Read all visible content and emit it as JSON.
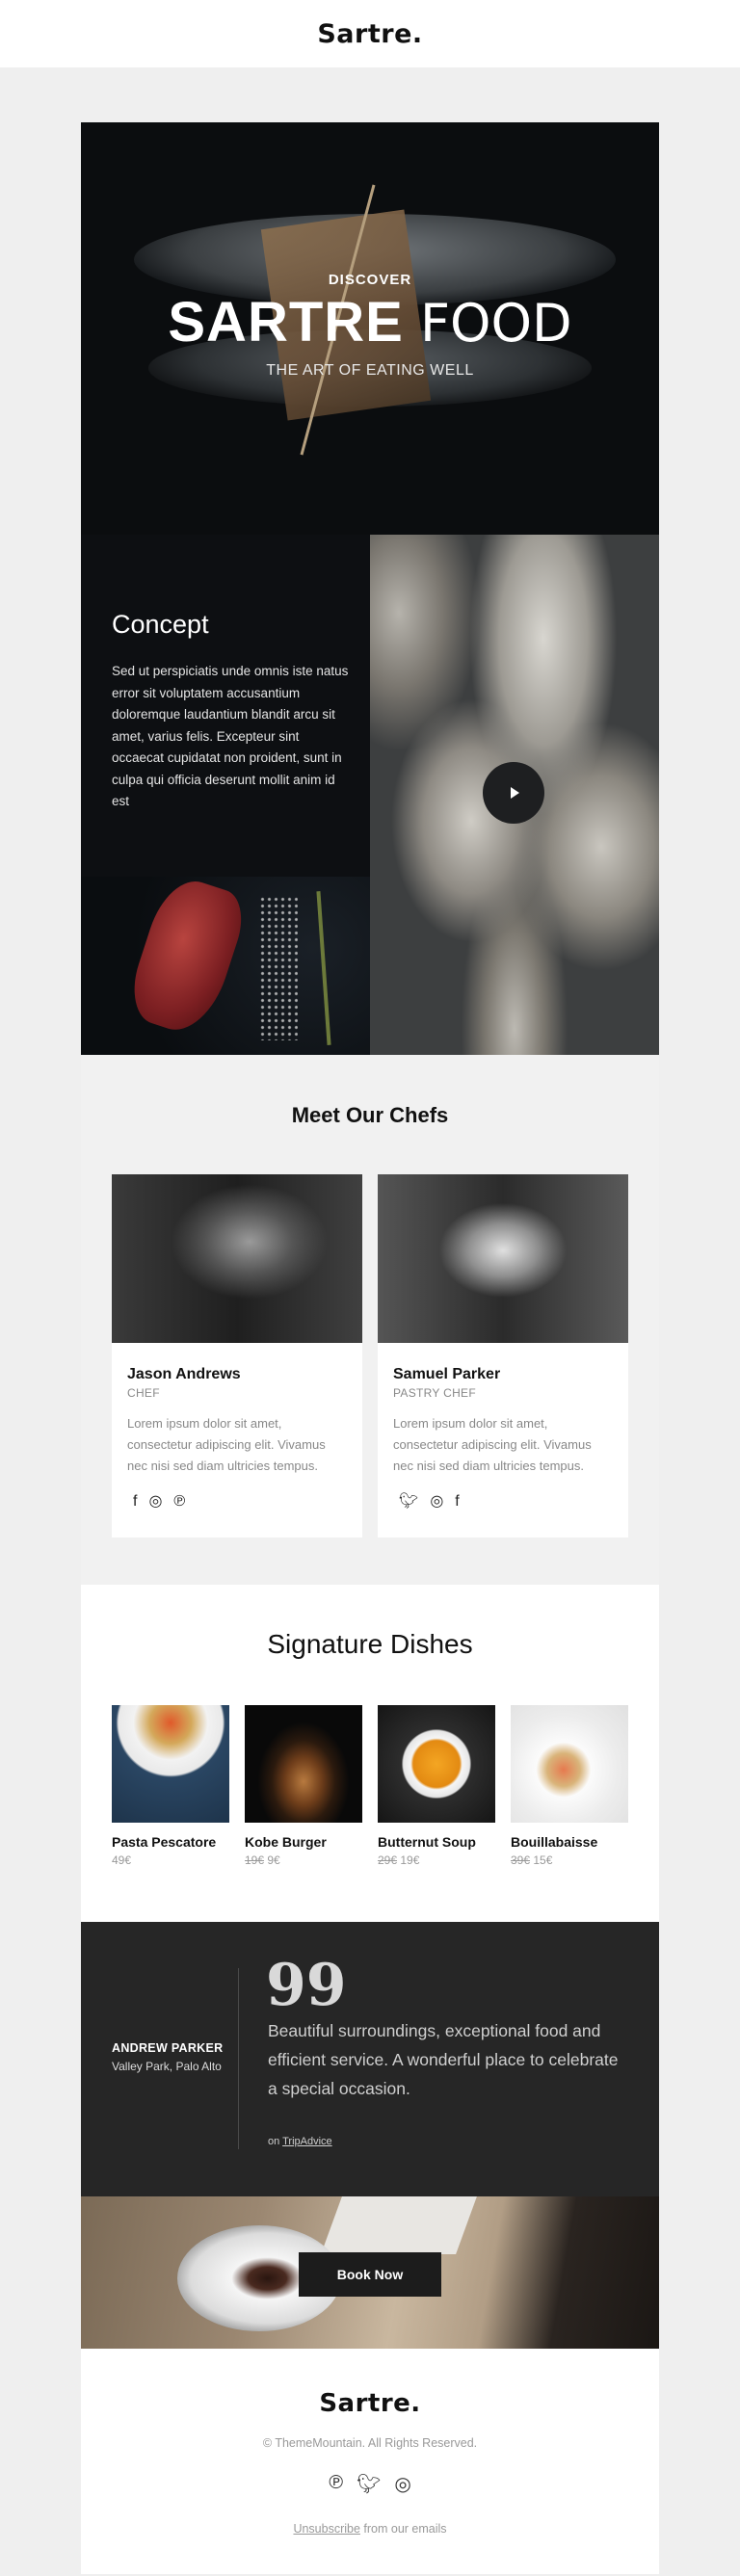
{
  "header": {
    "logo": "Sartre."
  },
  "hero": {
    "eyebrow": "DISCOVER",
    "title_bold": "SARTRE",
    "title_light": "FOOD",
    "tagline": "THE ART OF EATING WELL"
  },
  "concept": {
    "title": "Concept",
    "body": "Sed ut perspiciatis unde omnis iste natus error sit voluptatem accusantium doloremque laudantium blandit arcu sit amet, varius felis. Excepteur sint occaecat cupidatat non proident, sunt in culpa qui officia deserunt mollit anim id est",
    "play_icon": "play-icon"
  },
  "chefs": {
    "title": "Meet Our Chefs",
    "items": [
      {
        "name": "Jason Andrews",
        "role": "CHEF",
        "bio": "Lorem ipsum dolor sit amet, consectetur adipiscing elit. Vivamus nec nisi sed diam ultricies tempus.",
        "socials": [
          "facebook-icon",
          "instagram-icon",
          "pinterest-icon"
        ]
      },
      {
        "name": "Samuel Parker",
        "role": "PASTRY CHEF",
        "bio": "Lorem ipsum dolor sit amet, consectetur adipiscing elit. Vivamus nec nisi sed diam ultricies tempus.",
        "socials": [
          "twitter-icon",
          "instagram-icon",
          "facebook-icon"
        ]
      }
    ]
  },
  "dishes": {
    "title": "Signature Dishes",
    "items": [
      {
        "name": "Pasta Pescatore",
        "old_price": "",
        "price": "49€"
      },
      {
        "name": "Kobe Burger",
        "old_price": "19€",
        "price": "9€"
      },
      {
        "name": "Butternut Soup",
        "old_price": "29€",
        "price": "19€"
      },
      {
        "name": "Bouillabaisse",
        "old_price": "39€",
        "price": "15€"
      }
    ]
  },
  "testimonial": {
    "author": "ANDREW PARKER",
    "location": "Valley Park, Palo Alto",
    "quote_mark": "99",
    "text": "Beautiful surroundings, exceptional food and efficient service. A wonderful place to celebrate a special occasion.",
    "source_prefix": "on",
    "source_link": "TripAdvice"
  },
  "booking": {
    "button": "Book Now"
  },
  "footer": {
    "logo": "Sartre.",
    "copyright": "© ThemeMountain. All Rights Reserved.",
    "socials": [
      "pinterest-icon",
      "twitter-icon",
      "instagram-icon"
    ],
    "unsubscribe_link": "Unsubscribe",
    "unsubscribe_suffix": " from our emails"
  }
}
